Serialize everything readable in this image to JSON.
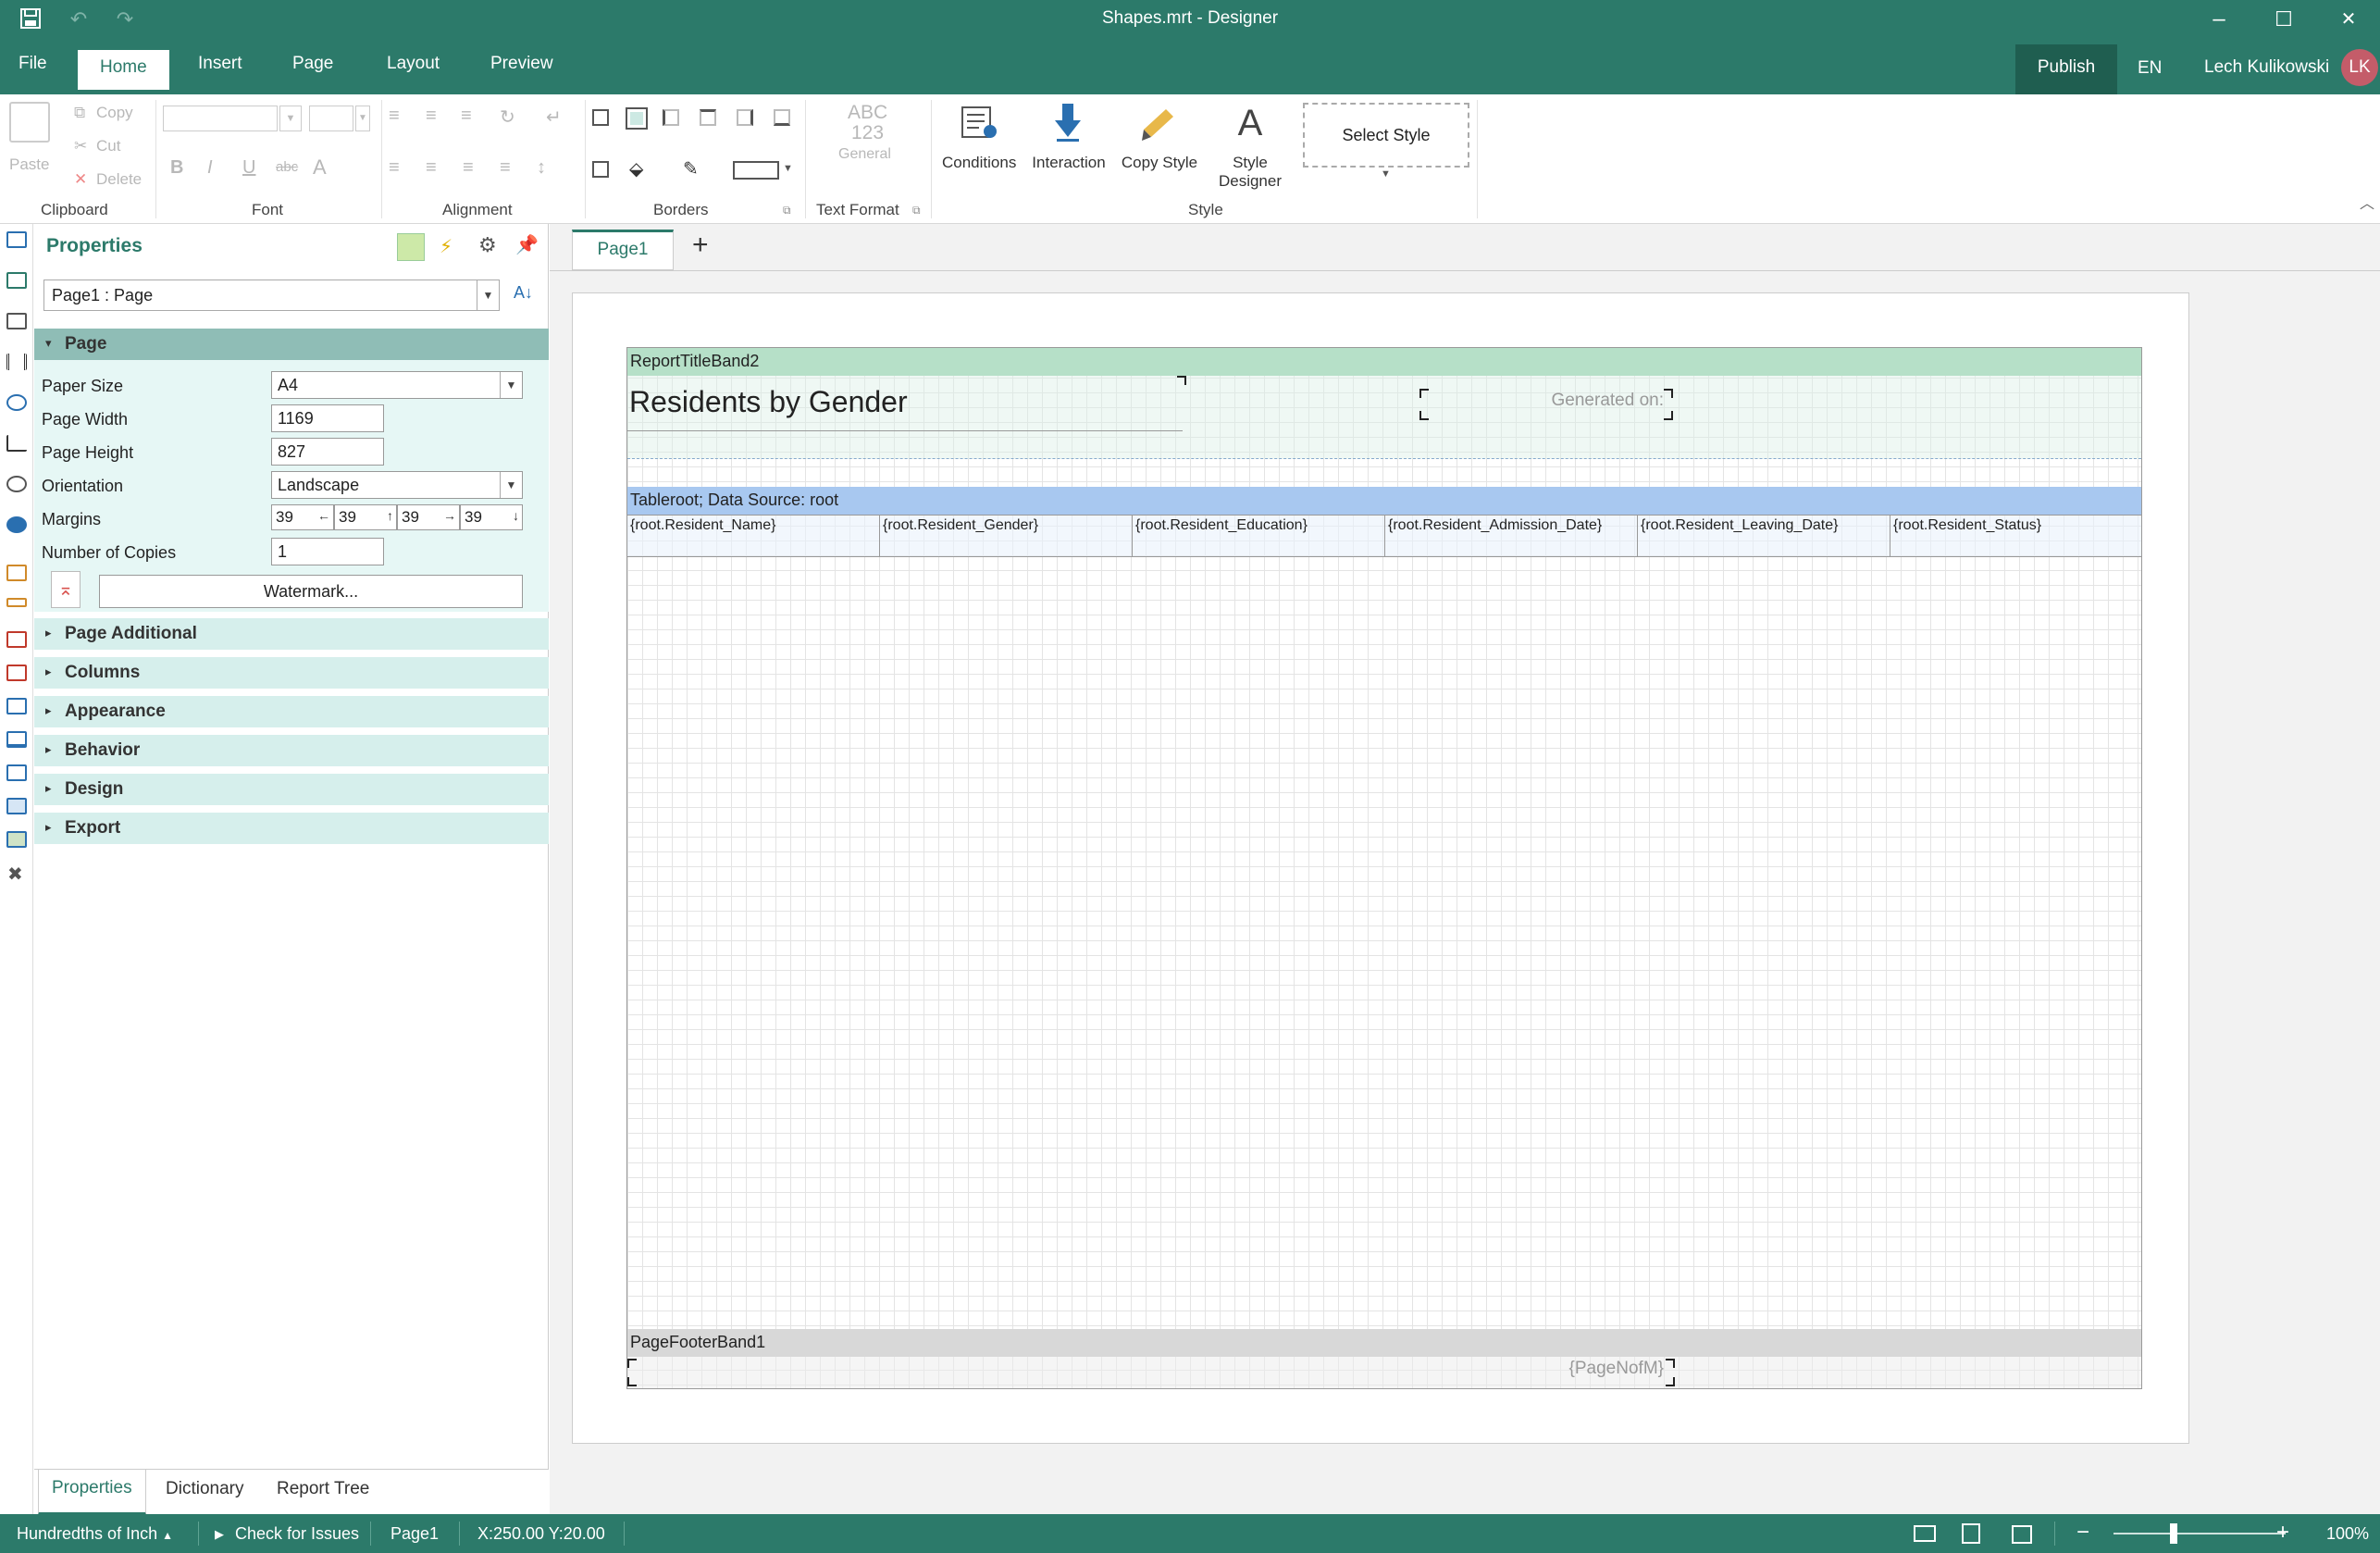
{
  "window": {
    "title": "Shapes.mrt - Designer",
    "minimize": "–",
    "maximize": "☐",
    "close": "✕"
  },
  "menu": {
    "items": [
      "File",
      "Home",
      "Insert",
      "Page",
      "Layout",
      "Preview"
    ],
    "active": "Home",
    "publish": "Publish",
    "language": "EN",
    "user": "Lech Kulikowski",
    "avatar_initials": "LK"
  },
  "ribbon": {
    "clipboard": {
      "paste": "Paste",
      "copy": "Copy",
      "cut": "Cut",
      "delete": "Delete",
      "label": "Clipboard"
    },
    "font": {
      "label": "Font"
    },
    "alignment": {
      "label": "Alignment"
    },
    "borders": {
      "label": "Borders"
    },
    "text_format": {
      "label": "Text Format",
      "preview_top": "ABC",
      "preview_mid": "123",
      "preview_bottom": "General"
    },
    "style": {
      "label": "Style",
      "conditions": "Conditions",
      "interaction": "Interaction",
      "copy_style": "Copy Style",
      "style_designer_1": "Style",
      "style_designer_2": "Designer",
      "select_style": "Select Style"
    }
  },
  "properties": {
    "title": "Properties",
    "selected_object": "Page1 : Page",
    "sections": {
      "page": "Page",
      "page_additional": "Page Additional",
      "columns": "Columns",
      "appearance": "Appearance",
      "behavior": "Behavior",
      "design": "Design",
      "export": "Export"
    },
    "fields": {
      "paper_size_label": "Paper Size",
      "paper_size": "A4",
      "page_width_label": "Page Width",
      "page_width": "1169",
      "page_height_label": "Page Height",
      "page_height": "827",
      "orientation_label": "Orientation",
      "orientation": "Landscape",
      "margins_label": "Margins",
      "margins": [
        "39",
        "39",
        "39",
        "39"
      ],
      "copies_label": "Number of Copies",
      "copies": "1",
      "watermark": "Watermark..."
    },
    "tabs": [
      "Properties",
      "Dictionary",
      "Report Tree"
    ]
  },
  "designer": {
    "page_tab": "Page1",
    "add_page": "+",
    "report_title_band": "ReportTitleBand2",
    "report_title": "Residents by Gender",
    "generated_on": "Generated on:",
    "table_band": "Tableroot; Data Source: root",
    "columns": [
      "{root.Resident_Name}",
      "{root.Resident_Gender}",
      "{root.Resident_Education}",
      "{root.Resident_Admission_Date}",
      "{root.Resident_Leaving_Date}",
      "{root.Resident_Status}"
    ],
    "footer_band": "PageFooterBand1",
    "page_n_of_m": "{PageNofM}"
  },
  "statusbar": {
    "units": "Hundredths of Inch",
    "check_issues": "Check for Issues",
    "page": "Page1",
    "coords": "X:250.00 Y:20.00",
    "zoom": "100%",
    "zoom_level": 0.35
  },
  "colors": {
    "accent": "#2c7a6a",
    "report_title_band": "#b6e0c8",
    "table_band": "#a8c8f0",
    "footer_band": "#d8d8d8"
  }
}
